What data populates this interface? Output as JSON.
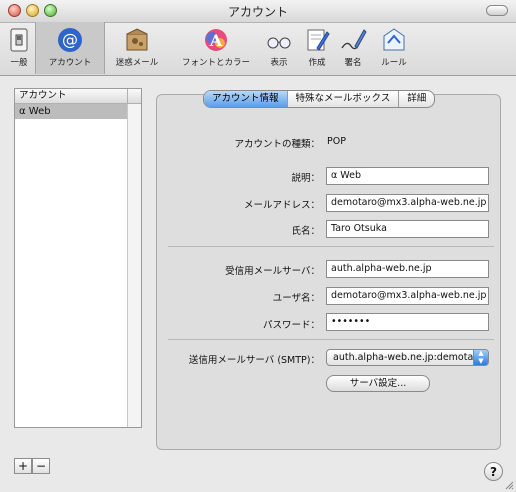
{
  "window": {
    "title": "アカウント"
  },
  "toolbar": {
    "items": [
      {
        "label": "一般",
        "icon": "light-switch-icon"
      },
      {
        "label": "アカウント",
        "icon": "at-sign-icon",
        "selected": true
      },
      {
        "label": "迷惑メール",
        "icon": "junk-mail-icon"
      },
      {
        "label": "フォントとカラー",
        "icon": "font-color-icon"
      },
      {
        "label": "表示",
        "icon": "glasses-icon"
      },
      {
        "label": "作成",
        "icon": "compose-icon"
      },
      {
        "label": "署名",
        "icon": "signature-pen-icon"
      },
      {
        "label": "ルール",
        "icon": "rules-icon"
      }
    ]
  },
  "accounts": {
    "header": "アカウント",
    "items": [
      {
        "name": "α Web",
        "selected": true
      }
    ]
  },
  "tabs": [
    {
      "label": "アカウント情報",
      "selected": true
    },
    {
      "label": "特殊なメールボックス",
      "selected": false
    },
    {
      "label": "詳細",
      "selected": false
    }
  ],
  "form": {
    "account_type_label": "アカウントの種類：",
    "account_type_value": "POP",
    "description_label": "説明：",
    "description_value": "α Web",
    "email_label": "メールアドレス：",
    "email_value": "demotaro@mx3.alpha-web.ne.jp",
    "name_label": "氏名：",
    "name_value": "Taro Otsuka",
    "incoming_label": "受信用メールサーバ：",
    "incoming_value": "auth.alpha-web.ne.jp",
    "username_label": "ユーザ名：",
    "username_value": "demotaro@mx3.alpha-web.ne.jp",
    "password_label": "パスワード：",
    "password_value": "•••••••",
    "smtp_label": "送信用メールサーバ (SMTP)：",
    "smtp_value": "auth.alpha-web.ne.jp:demota",
    "server_settings_button": "サーバ設定..."
  },
  "footer": {
    "add": "+",
    "remove": "−",
    "help": "?"
  }
}
